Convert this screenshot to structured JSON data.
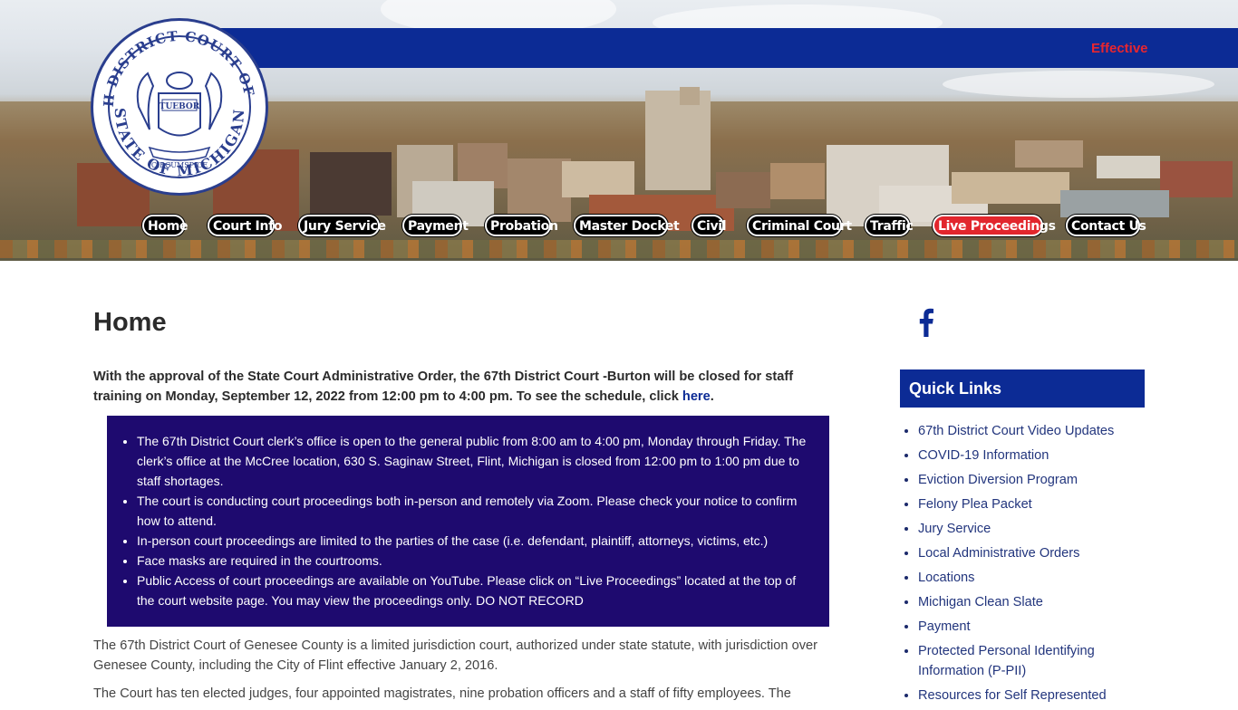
{
  "header": {
    "ticker_text": "Effective",
    "seal": {
      "outer_text_top": "67TH DISTRICT COURT OF THE",
      "outer_text_bottom": "STATE OF MICHIGAN",
      "motto": "TUEBOR",
      "ribbon": "CIRCUMSPICE"
    },
    "nav": [
      {
        "label": "Home"
      },
      {
        "label": "Court Info"
      },
      {
        "label": "Jury Service"
      },
      {
        "label": "Payment"
      },
      {
        "label": "Probation"
      },
      {
        "label": "Master Docket"
      },
      {
        "label": "Civil"
      },
      {
        "label": "Criminal Court"
      },
      {
        "label": "Traffic"
      },
      {
        "label": "Live Proceedings"
      },
      {
        "label": "Contact Us"
      }
    ]
  },
  "main": {
    "title": "Home",
    "notice_text": "With the approval of the State Court Administrative Order, the 67th District Court -Burton will be closed for staff training on Monday, September 12, 2022 from 12:00 pm to 4:00 pm. To see the schedule, click",
    "notice_link": "here",
    "notice_end": ".",
    "bullets": [
      "The 67th District Court clerk’s office is open to the general public from 8:00 am to 4:00 pm, Monday through Friday. The clerk’s office at the McCree location, 630 S. Saginaw Street, Flint, Michigan is closed from 12:00 pm to 1:00 pm due to staff shortages.",
      "The court is conducting court proceedings both in-person and remotely via Zoom. Please check your notice to confirm how to attend.",
      "In-person court proceedings are limited to the parties of the case (i.e. defendant, plaintiff, attorneys, victims, etc.)",
      "Face masks are required in the courtrooms.",
      "Public Access of court proceedings are available on YouTube. Please click on “Live Proceedings” located at the top of the court website page. You may view the proceedings only. DO NOT RECORD"
    ],
    "paragraph1": "The 67th District Court of Genesee County is a limited jurisdiction court, authorized under state statute, with jurisdiction over Genesee County, including the City of Flint effective January 2, 2016.",
    "paragraph2": "The Court has ten elected judges, four appointed magistrates, nine probation officers and a staff of fifty employees. The"
  },
  "sidebar": {
    "quick_links_title": "Quick Links",
    "links": [
      "67th District Court Video Updates",
      "COVID-19 Information",
      "Eviction Diversion Program",
      "Felony Plea Packet",
      "Jury Service",
      "Local Administrative Orders",
      "Locations",
      "Michigan Clean Slate",
      "Payment",
      "Protected Personal Identifying Information (P-PII)",
      "Resources for Self Represented"
    ]
  },
  "colors": {
    "brand_blue": "#0c2b95",
    "notice_purple": "#1e0a6f",
    "live_red": "#e2262d"
  }
}
